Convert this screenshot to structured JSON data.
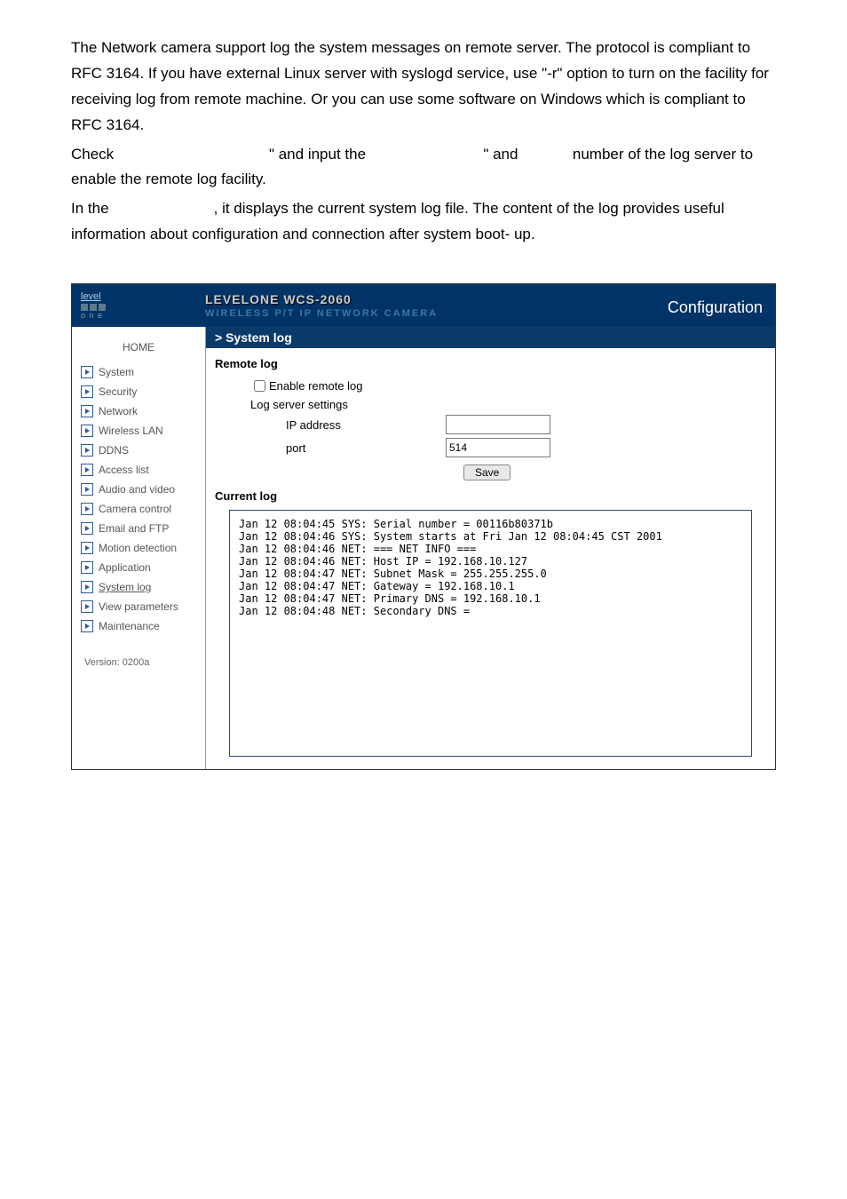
{
  "description": {
    "p1": "The Network camera support log the system messages on remote server. The protocol is compliant to RFC 3164. If you have external Linux server with syslogd service, use \"-r\" option to turn on the facility for receiving log from remote machine. Or you can use some software on Windows which is compliant to RFC 3164.",
    "p2_a": "Check ",
    "p2_b": "\" and input the ",
    "p2_c": "\" and ",
    "p2_d": "number of the log server to enable the remote log facility.",
    "p3_a": "In the ",
    "p3_b": ", it displays the current system log file. The content of the log provides useful information about configuration and connection after system boot- up."
  },
  "logo": {
    "text": "level",
    "sub": "o n e"
  },
  "title": {
    "main": "LEVELONE WCS-2060",
    "sub": "WIRELESS P/T IP NETWORK CAMERA"
  },
  "config_link": "Configuration",
  "sidebar": {
    "home": "HOME",
    "items": [
      {
        "label": "System"
      },
      {
        "label": "Security"
      },
      {
        "label": "Network"
      },
      {
        "label": "Wireless LAN"
      },
      {
        "label": "DDNS"
      },
      {
        "label": "Access list"
      },
      {
        "label": "Audio and video"
      },
      {
        "label": "Camera control"
      },
      {
        "label": "Email and FTP"
      },
      {
        "label": "Motion detection"
      },
      {
        "label": "Application"
      },
      {
        "label": "System log",
        "active": true
      },
      {
        "label": "View parameters"
      },
      {
        "label": "Maintenance"
      }
    ],
    "version": "Version: 0200a"
  },
  "breadcrumb": "> System log",
  "remote_log": {
    "title": "Remote log",
    "enable_label": "Enable remote log",
    "settings_label": "Log server settings",
    "ip_label": "IP address",
    "ip_value": "",
    "port_label": "port",
    "port_value": "514",
    "save_label": "Save"
  },
  "current_log": {
    "title": "Current log",
    "lines": "Jan 12 08:04:45 SYS: Serial number = 00116b80371b\nJan 12 08:04:46 SYS: System starts at Fri Jan 12 08:04:45 CST 2001\nJan 12 08:04:46 NET: === NET INFO ===\nJan 12 08:04:46 NET: Host IP = 192.168.10.127\nJan 12 08:04:47 NET: Subnet Mask = 255.255.255.0\nJan 12 08:04:47 NET: Gateway = 192.168.10.1\nJan 12 08:04:47 NET: Primary DNS = 192.168.10.1\nJan 12 08:04:48 NET: Secondary DNS ="
  }
}
